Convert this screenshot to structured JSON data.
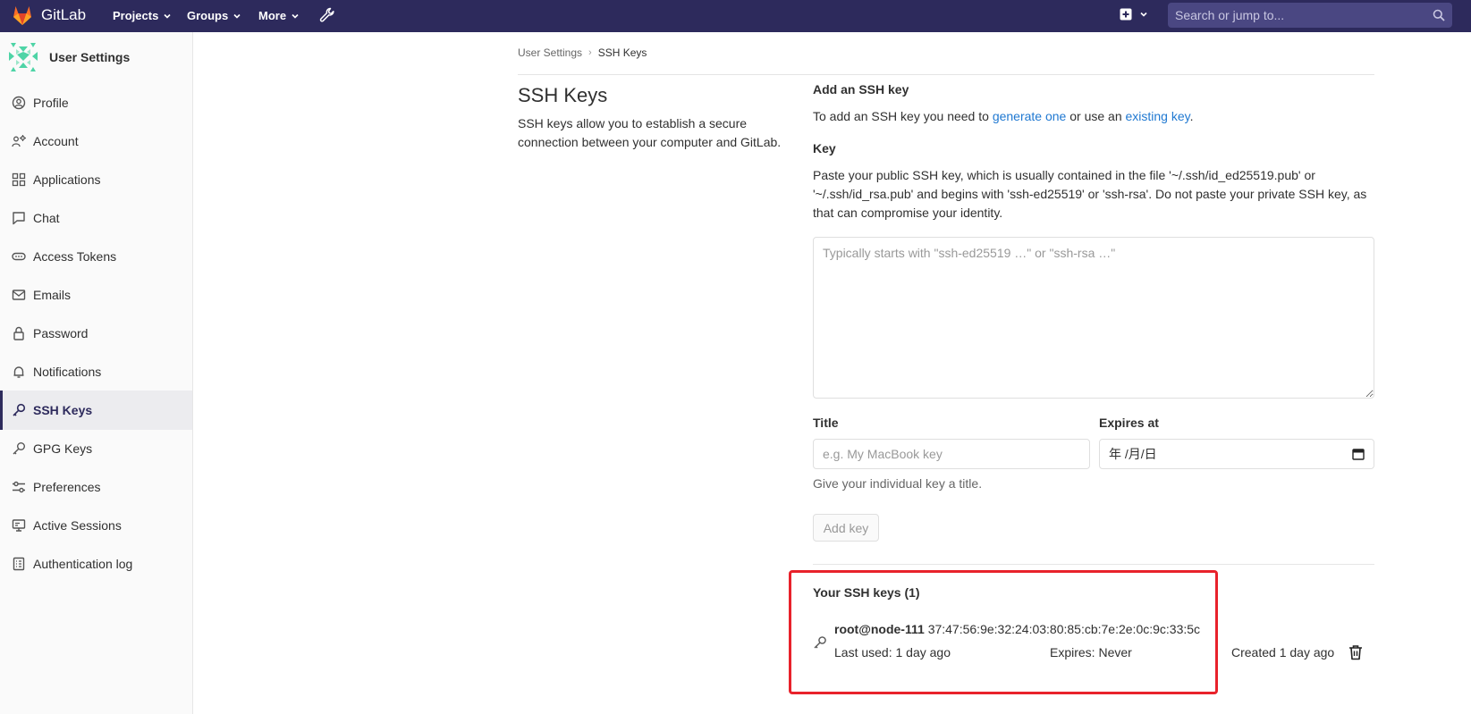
{
  "navbar": {
    "brand": "GitLab",
    "menus": [
      "Projects",
      "Groups",
      "More"
    ],
    "search_placeholder": "Search or jump to..."
  },
  "sidebar": {
    "title": "User Settings",
    "items": [
      {
        "label": "Profile",
        "icon": "user-icon"
      },
      {
        "label": "Account",
        "icon": "account-icon"
      },
      {
        "label": "Applications",
        "icon": "applications-icon"
      },
      {
        "label": "Chat",
        "icon": "chat-icon"
      },
      {
        "label": "Access Tokens",
        "icon": "token-icon"
      },
      {
        "label": "Emails",
        "icon": "mail-icon"
      },
      {
        "label": "Password",
        "icon": "lock-icon"
      },
      {
        "label": "Notifications",
        "icon": "bell-icon"
      },
      {
        "label": "SSH Keys",
        "icon": "key-icon",
        "active": true
      },
      {
        "label": "GPG Keys",
        "icon": "key-icon"
      },
      {
        "label": "Preferences",
        "icon": "preferences-icon"
      },
      {
        "label": "Active Sessions",
        "icon": "monitor-icon"
      },
      {
        "label": "Authentication log",
        "icon": "log-icon"
      }
    ]
  },
  "breadcrumb": {
    "parent": "User Settings",
    "separator": "›",
    "current": "SSH Keys"
  },
  "page": {
    "title": "SSH Keys",
    "description": "SSH keys allow you to establish a secure connection between your computer and GitLab."
  },
  "add_key": {
    "title": "Add an SSH key",
    "intro_prefix": "To add an SSH key you need to ",
    "link_generate": "generate one",
    "intro_middle": " or use an ",
    "link_existing": "existing key",
    "intro_suffix": ".",
    "key_label": "Key",
    "key_help": "Paste your public SSH key, which is usually contained in the file '~/.ssh/id_ed25519.pub' or '~/.ssh/id_rsa.pub' and begins with 'ssh-ed25519' or 'ssh-rsa'. Do not paste your private SSH key, as that can compromise your identity.",
    "key_placeholder": "Typically starts with \"ssh-ed25519 …\" or \"ssh-rsa …\"",
    "title_label": "Title",
    "title_placeholder": "e.g. My MacBook key",
    "expires_label": "Expires at",
    "expires_value": "年 /月/日",
    "title_hint": "Give your individual key a title.",
    "submit_label": "Add key"
  },
  "your_keys": {
    "title": "Your SSH keys (1)",
    "keys": [
      {
        "name": "root@node-111",
        "fingerprint": "37:47:56:9e:32:24:03:80:85:cb:7e:2e:0c:9c:33:5c",
        "last_used": "Last used: 1 day ago",
        "expires": "Expires: Never",
        "created": "Created 1 day ago"
      }
    ]
  },
  "colors": {
    "navbar": "#2d2a5c",
    "link": "#1f78d1",
    "highlight": "#e8222b"
  }
}
